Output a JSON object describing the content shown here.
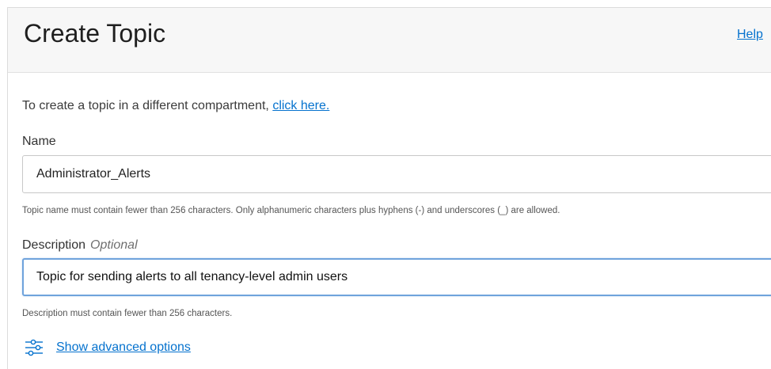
{
  "header": {
    "title": "Create Topic",
    "help_label": "Help"
  },
  "intro": {
    "text": "To create a topic in a different compartment, ",
    "link_label": "click here."
  },
  "name_field": {
    "label": "Name",
    "value": "Administrator_Alerts",
    "hint": "Topic name must contain fewer than 256 characters. Only alphanumeric characters plus hyphens (-) and underscores (_) are allowed."
  },
  "description_field": {
    "label": "Description",
    "optional_label": "Optional",
    "value": "Topic for sending alerts to all tenancy-level admin users",
    "hint": "Description must contain fewer than 256 characters."
  },
  "advanced": {
    "label": "Show advanced options",
    "icon": "sliders-icon"
  },
  "colors": {
    "link": "#0572ce",
    "header_bg": "#f7f7f7",
    "focus_border": "#6fa3dc"
  }
}
